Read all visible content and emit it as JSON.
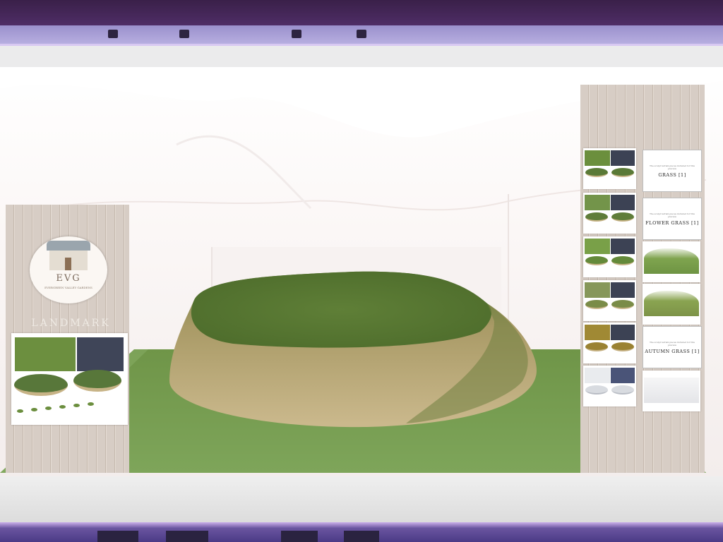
{
  "sign": {
    "logo_letters": "EVG",
    "logo_subtitle": "EVERGREEN VALLEY GARDENS",
    "title": "LANDMARK"
  },
  "right_poster": {
    "captions": [
      "GRASS [1]",
      "FLOWER GRASS [1]",
      "AUTUMN GRASS [1]"
    ],
    "small_note": "The sculpt terrain pieces included for this preview"
  },
  "colors": {
    "frame_purple": "#4e2d66",
    "frame_lavender": "#b7aee0",
    "grass_green": "#5f7d3a",
    "dry_grass": "#b9a676",
    "wall": "#faf6f5",
    "wood_panel": "#d7cdc5"
  }
}
